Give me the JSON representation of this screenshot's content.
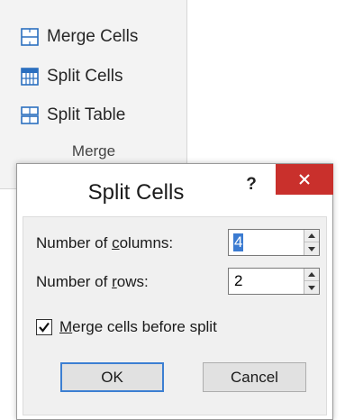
{
  "ribbon": {
    "merge_cells": {
      "label": "Merge Cells",
      "icon": "merge-cells-icon"
    },
    "split_cells": {
      "label": "Split Cells",
      "icon": "split-cells-icon"
    },
    "split_table": {
      "label": "Split Table",
      "icon": "split-table-icon"
    },
    "group_label": "Merge"
  },
  "dialog": {
    "title": "Split Cells",
    "help_label": "?",
    "close_icon": "close-icon",
    "columns": {
      "label_pre": "Number of ",
      "label_key": "c",
      "label_post": "olumns:",
      "value": "4"
    },
    "rows": {
      "label_pre": "Number of ",
      "label_key": "r",
      "label_post": "ows:",
      "value": "2"
    },
    "merge_before_split": {
      "label_key": "M",
      "label_post": "erge cells before split",
      "checked": true
    },
    "ok_label": "OK",
    "cancel_label": "Cancel"
  },
  "colors": {
    "close_button": "#c9302c",
    "selection": "#3b7bd1",
    "icon_blue": "#2b6fbf"
  }
}
